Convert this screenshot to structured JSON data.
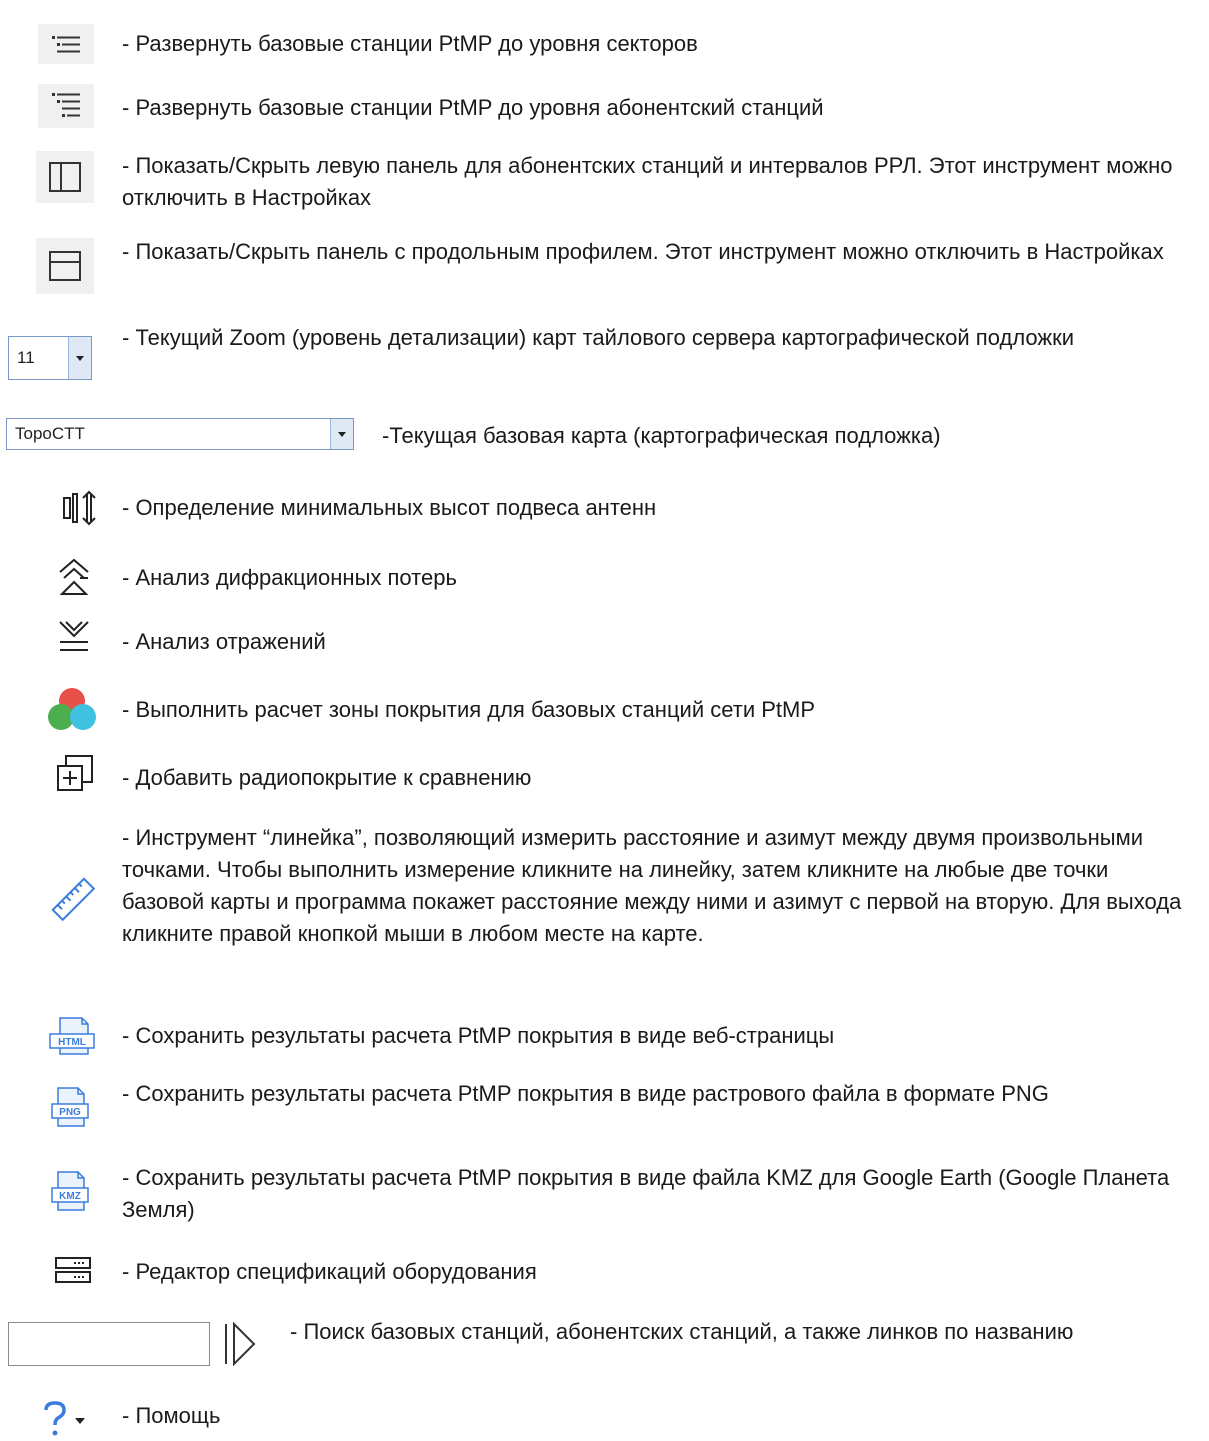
{
  "items": [
    {
      "icon": "expand-sectors-icon",
      "text": "- Развернуть базовые станции PtMP до уровня секторов"
    },
    {
      "icon": "expand-subscribers-icon",
      "text": "- Развернуть базовые станции PtMP до уровня абонентский станций"
    },
    {
      "icon": "left-panel-icon",
      "text": "- Показать/Скрыть левую панель для абонентских станций и интервалов РРЛ. Этот инструмент можно отключить в Настройках"
    },
    {
      "icon": "profile-panel-icon",
      "text": "- Показать/Скрыть панель с продольным профилем. Этот инструмент можно отключить в Настройках"
    },
    {
      "icon": "zoom-select",
      "text": "- Текущий Zoom (уровень детализации) карт тайлового сервера картографической подложки"
    },
    {
      "icon": "basemap-select",
      "text": "-Текущая базовая карта (картографическая подложка)"
    },
    {
      "icon": "antenna-height-icon",
      "text": "- Определение минимальных высот подвеса антенн"
    },
    {
      "icon": "diffraction-icon",
      "text": "- Анализ дифракционных потерь"
    },
    {
      "icon": "reflection-icon",
      "text": "- Анализ отражений"
    },
    {
      "icon": "coverage-icon",
      "text": "- Выполнить расчет зоны покрытия для базовых станций сети PtMP"
    },
    {
      "icon": "add-compare-icon",
      "text": "- Добавить радиопокрытие к сравнению"
    },
    {
      "icon": "ruler-icon",
      "text": "- Инструмент “линейка”, позволяющий измерить расстояние и азимут между двумя произвольными точками. Чтобы выполнить измерение кликните на линейку, затем кликните на любые две точки базовой карты и программа покажет расстояние между ними и азимут с первой на вторую. Для выхода кликните правой кнопкой мыши в любом месте на карте."
    },
    {
      "icon": "html-file-icon",
      "text": "- Сохранить результаты расчета PtMP покрытия в виде веб-страницы"
    },
    {
      "icon": "png-file-icon",
      "text": "- Сохранить результаты расчета PtMP покрытия в виде растрового файла в формате PNG"
    },
    {
      "icon": "kmz-file-icon",
      "text": "- Сохранить результаты расчета PtMP покрытия в виде файла KMZ для Google Earth (Google Планета Земля)"
    },
    {
      "icon": "equipment-editor-icon",
      "text": "- Редактор спецификаций оборудования"
    },
    {
      "icon": "search-input",
      "text": "- Поиск базовых станций, абонентских станций, а также линков по названию"
    },
    {
      "icon": "help-icon",
      "text": "- Помощь"
    }
  ],
  "controls": {
    "zoom_value": "11",
    "basemap_value": "TopoCTT",
    "html_label": "HTML",
    "png_label": "PNG",
    "kmz_label": "KMZ",
    "search_value": ""
  },
  "colors": {
    "icon_bg": "#f0f0f0",
    "combo_border": "#7a98c7",
    "coverage_red": "#e8504a",
    "coverage_green": "#4cae4f",
    "coverage_cyan": "#3ec2e0",
    "file_blue": "#3b7ddd"
  }
}
